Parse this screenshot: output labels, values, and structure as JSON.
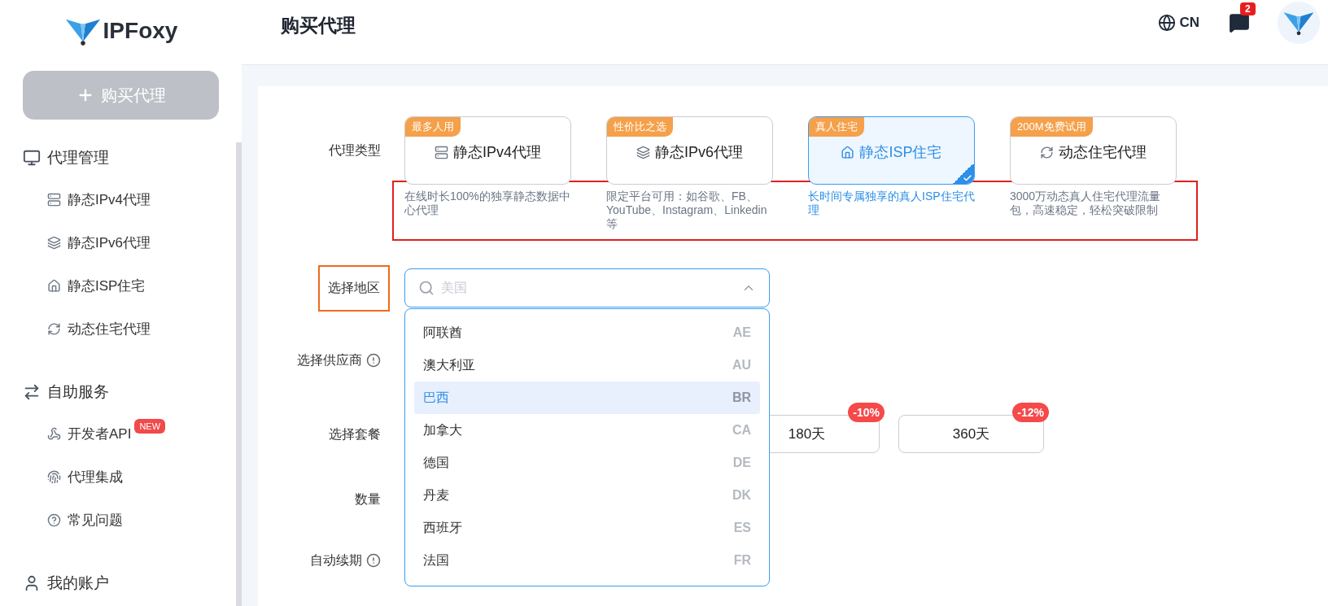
{
  "sidebar": {
    "logo_text": "IPFoxy",
    "buy_button": "购买代理",
    "groups": [
      {
        "title": "代理管理",
        "items": [
          {
            "label": "静态IPv4代理"
          },
          {
            "label": "静态IPv6代理"
          },
          {
            "label": "静态ISP住宅"
          },
          {
            "label": "动态住宅代理"
          }
        ]
      },
      {
        "title": "自助服务",
        "items": [
          {
            "label": "开发者API",
            "badge": "NEW"
          },
          {
            "label": "代理集成"
          },
          {
            "label": "常见问题"
          }
        ]
      },
      {
        "title": "我的账户"
      }
    ]
  },
  "header": {
    "title": "购买代理",
    "language": "CN",
    "message_count": "2"
  },
  "form": {
    "proxy_type": {
      "label": "代理类型",
      "descriptions_highlighted": true,
      "options": [
        {
          "tag": "最多人用",
          "name": "静态IPv4代理",
          "description": "在线时长100%的独享静态数据中心代理",
          "selected": false
        },
        {
          "tag": "性价比之选",
          "name": "静态IPv6代理",
          "description": "限定平台可用：如谷歌、FB、YouTube、Instagram、Linkedin等",
          "selected": false
        },
        {
          "tag": "真人住宅",
          "name": "静态ISP住宅",
          "description": "长时间专属独享的真人ISP住宅代理",
          "selected": true
        },
        {
          "tag": "200M免费试用",
          "name": "动态住宅代理",
          "description": "3000万动态真人住宅代理流量包，高速稳定，轻松突破限制",
          "selected": false
        }
      ]
    },
    "region": {
      "label": "选择地区",
      "label_highlighted": true,
      "placeholder": "美国",
      "expanded": true,
      "options": [
        {
          "name": "阿联酋",
          "code": "AE",
          "selected": false
        },
        {
          "name": "澳大利亚",
          "code": "AU",
          "selected": false
        },
        {
          "name": "巴西",
          "code": "BR",
          "selected": true
        },
        {
          "name": "加拿大",
          "code": "CA",
          "selected": false
        },
        {
          "name": "德国",
          "code": "DE",
          "selected": false
        },
        {
          "name": "丹麦",
          "code": "DK",
          "selected": false
        },
        {
          "name": "西班牙",
          "code": "ES",
          "selected": false
        },
        {
          "name": "法国",
          "code": "FR",
          "selected": false
        }
      ]
    },
    "supplier": {
      "label": "选择供应商"
    },
    "plan": {
      "label": "选择套餐",
      "options": [
        {
          "label": "180天",
          "discount": "-10%"
        },
        {
          "label": "360天",
          "discount": "-12%"
        }
      ]
    },
    "quantity": {
      "label": "数量"
    },
    "auto_renew": {
      "label": "自动续期"
    }
  }
}
